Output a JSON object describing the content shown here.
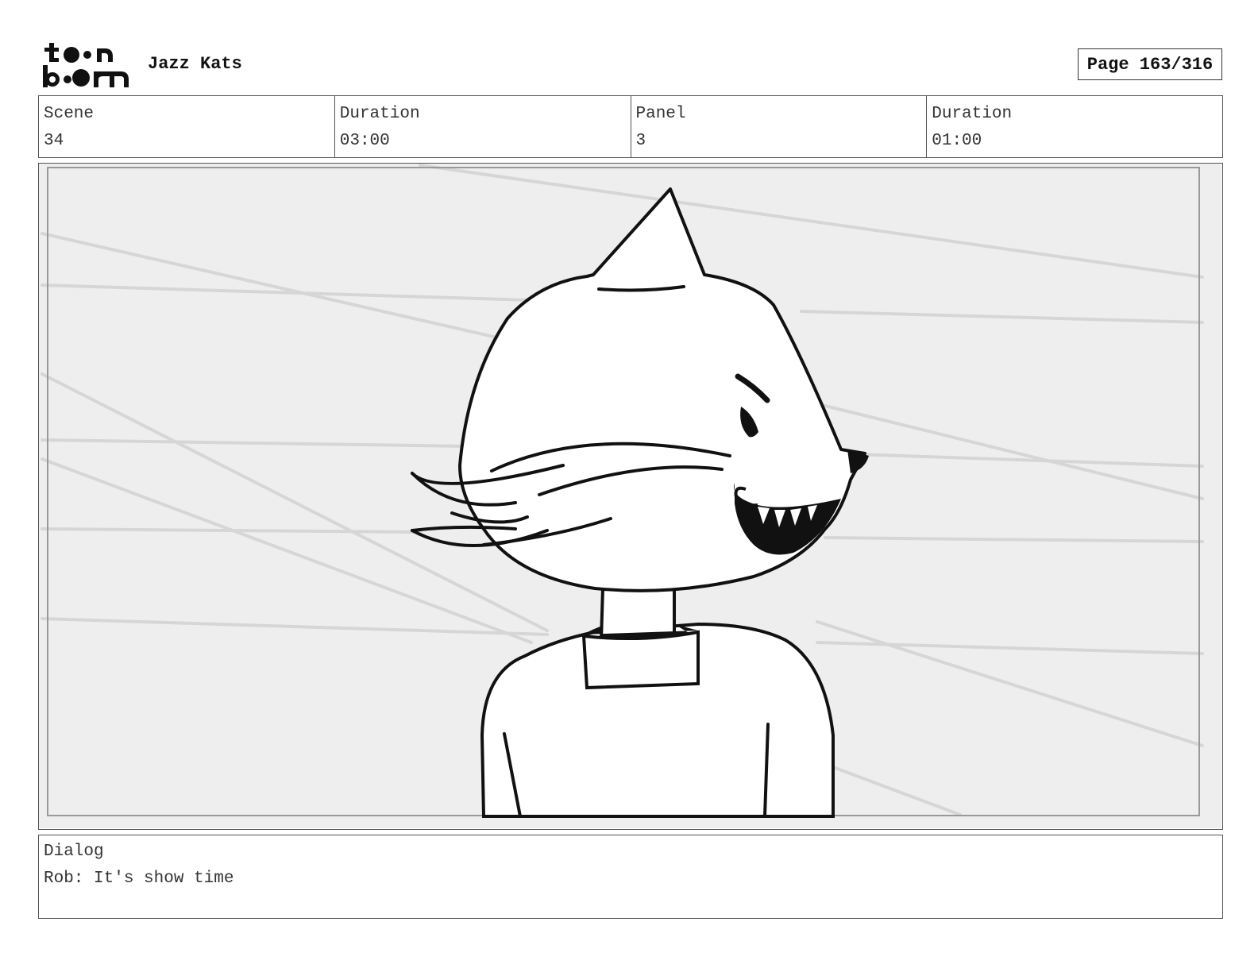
{
  "header": {
    "logo_icon": "toon-boom-logo",
    "project_title": "Jazz Kats",
    "page_label": "Page 163/316"
  },
  "info": {
    "scene_label": "Scene",
    "scene_value": "34",
    "scene_duration_label": "Duration",
    "scene_duration_value": "03:00",
    "panel_label": "Panel",
    "panel_value": "3",
    "panel_duration_label": "Duration",
    "panel_duration_value": "01:00"
  },
  "panel": {
    "image_description_icon": "cat-character-sketch",
    "background_color": "#eeeeee"
  },
  "dialog": {
    "label": "Dialog",
    "text": "Rob: It's show time"
  }
}
